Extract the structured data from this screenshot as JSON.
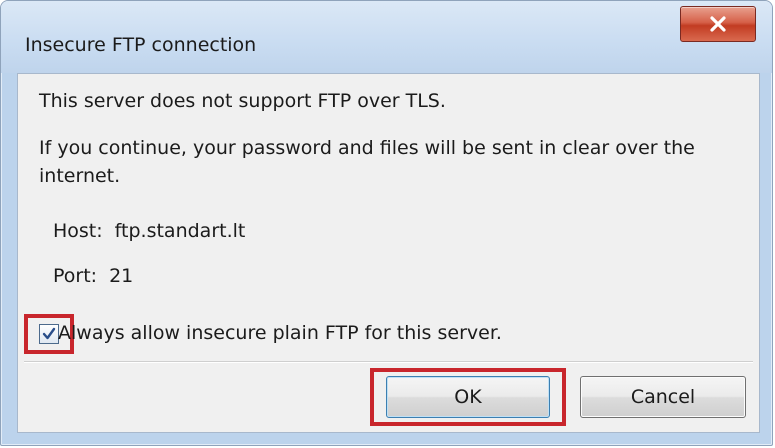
{
  "dialog": {
    "title": "Insecure FTP connection",
    "close_glyph": "X",
    "message_line1": "This server does not support FTP over TLS.",
    "message_line2": "If you continue, your password and files will be sent in clear over the internet.",
    "host_label": "Host:",
    "host_value": "ftp.standart.lt",
    "port_label": "Port:",
    "port_value": "21",
    "checkbox_label": "Always allow insecure plain FTP for this server.",
    "checkbox_checked": true,
    "ok_label": "OK",
    "cancel_label": "Cancel",
    "highlight_color": "#c8262c"
  }
}
